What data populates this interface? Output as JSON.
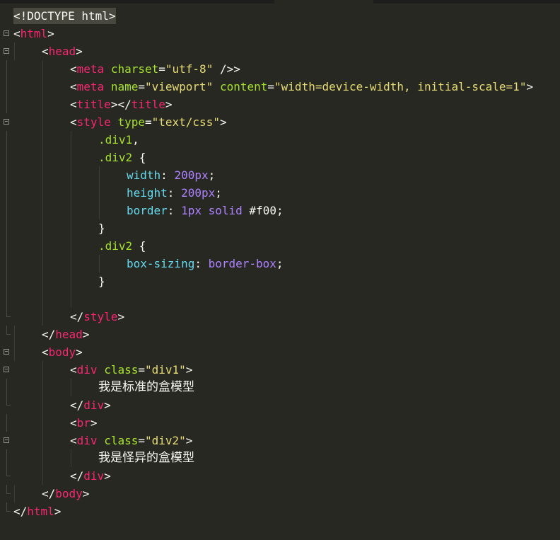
{
  "editor": {
    "theme": "monokai",
    "colors": {
      "background": "#272822",
      "tag": "#f92672",
      "attribute": "#a6e22e",
      "string": "#e6db74",
      "property": "#66d9ef",
      "value": "#ae81ff"
    }
  },
  "code": {
    "doctype": "<!DOCTYPE html>",
    "html_open": "html",
    "head_open": "head",
    "meta1": {
      "tag": "meta",
      "attr": "charset",
      "value": "\"utf-8\"",
      "close": " />"
    },
    "meta2": {
      "tag": "meta",
      "attr1": "name",
      "value1": "\"viewport\"",
      "attr2": "content",
      "value2": "\"width=device-width, initial-scale=1\""
    },
    "title_tag": "title",
    "style_open": {
      "tag": "style",
      "attr": "type",
      "value": "\"text/css\""
    },
    "css": {
      "sel1": ".div1",
      "sel2": ".div2",
      "width_prop": "width",
      "width_val": "200px",
      "height_prop": "height",
      "height_val": "200px",
      "border_prop": "border",
      "border_val1": "1px",
      "border_val2": "solid",
      "border_val3": "#f00",
      "sel3": ".div2",
      "box_prop": "box-sizing",
      "box_val": "border-box"
    },
    "style_close": "style",
    "head_close": "head",
    "body_open": "body",
    "div1": {
      "tag": "div",
      "attr": "class",
      "value": "\"div1\"",
      "text": "我是标准的盒模型"
    },
    "br_tag": "br",
    "div2": {
      "tag": "div",
      "attr": "class",
      "value": "\"div2\"",
      "text": "我是怪异的盒模型"
    },
    "div_close": "div",
    "body_close": "body",
    "html_close": "html"
  }
}
